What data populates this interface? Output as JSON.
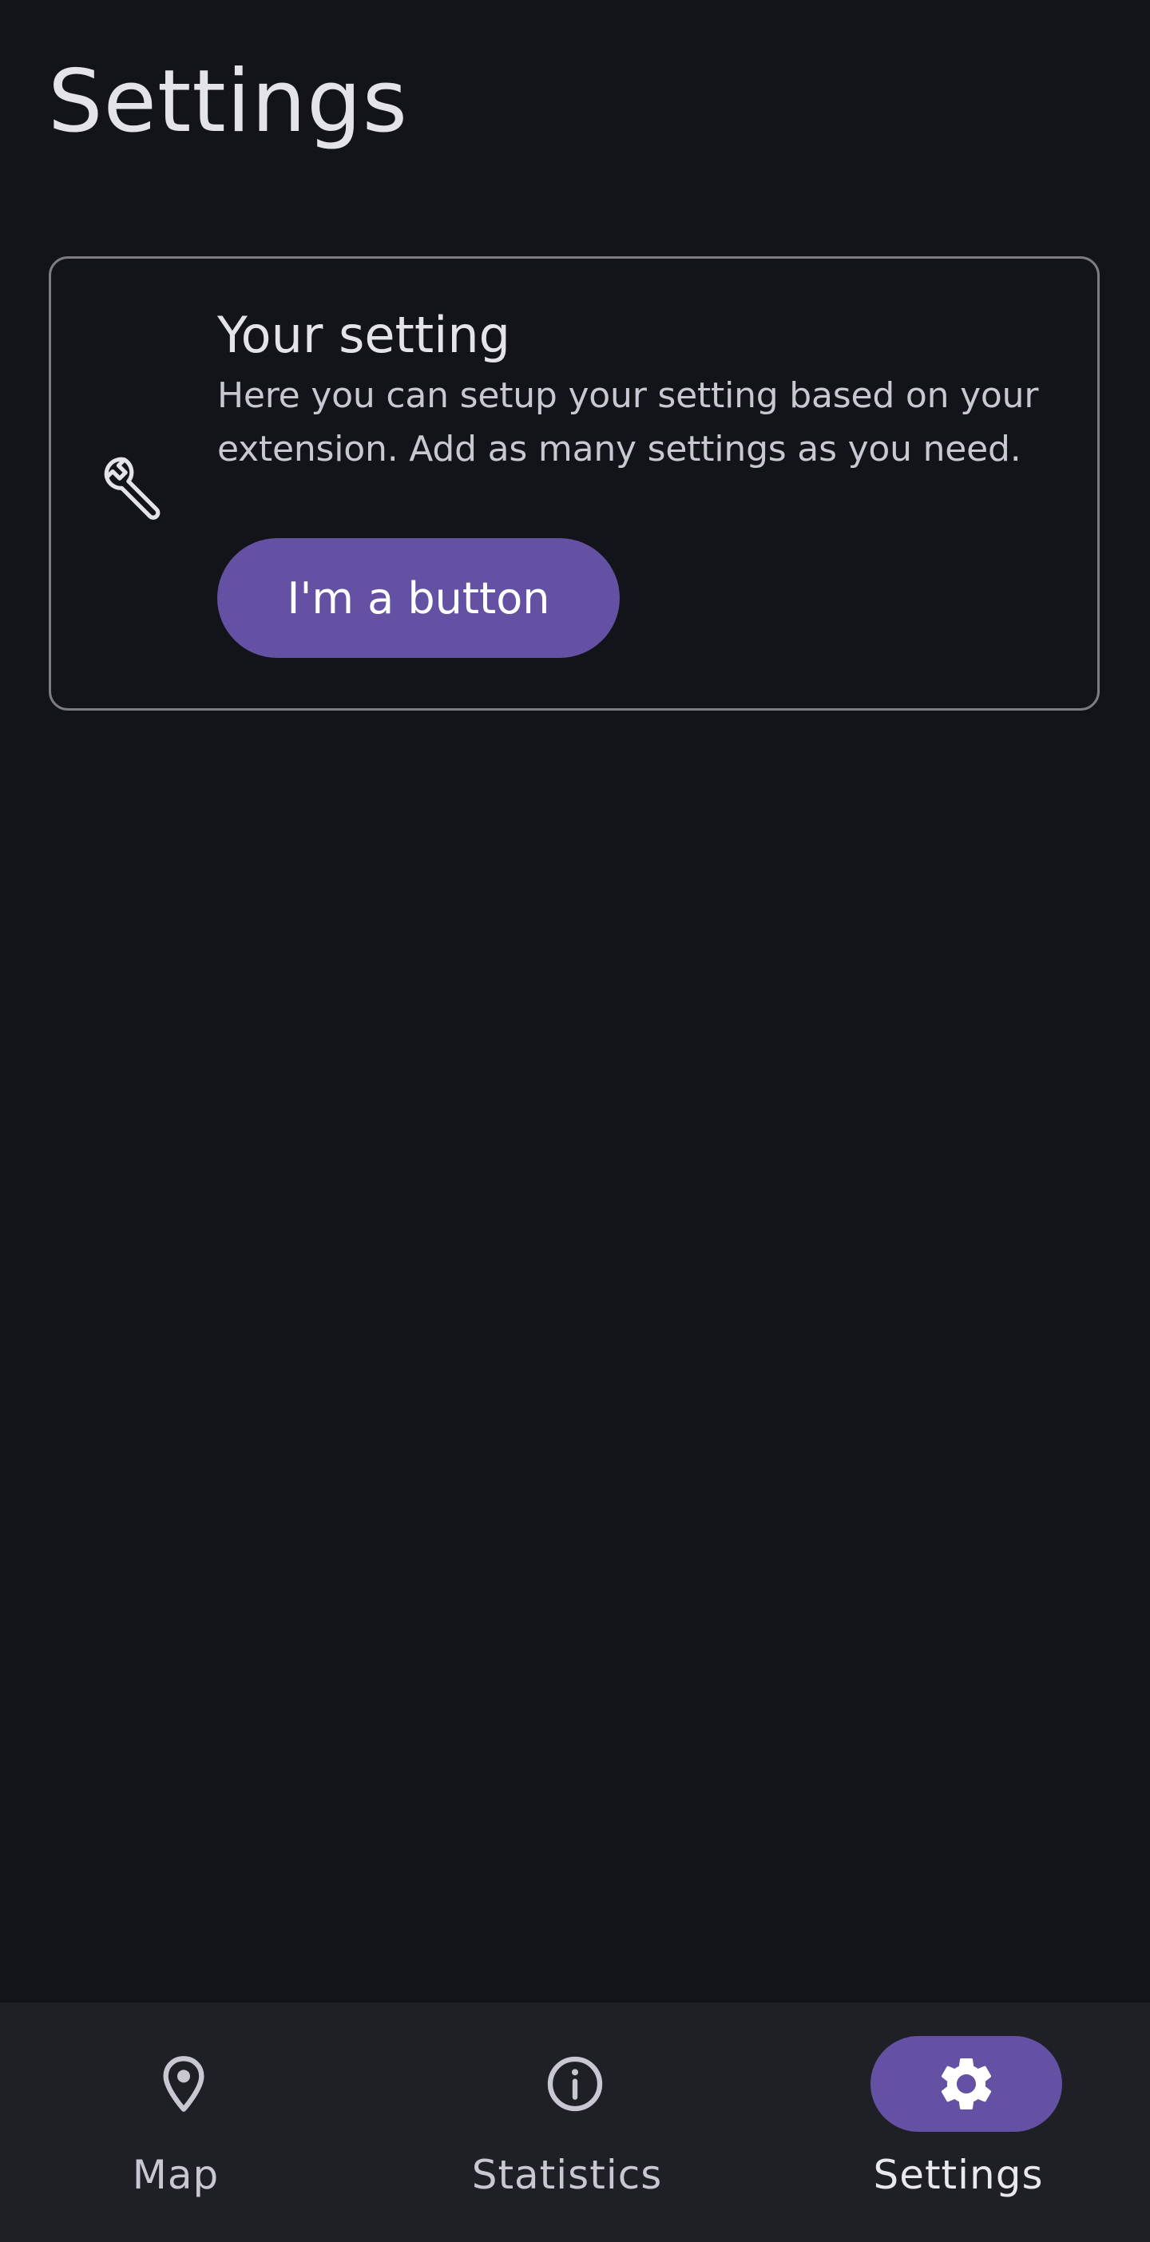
{
  "page": {
    "title": "Settings"
  },
  "setting_card": {
    "icon": "wrench-icon",
    "title": "Your setting",
    "description": "Here you can setup your setting based on your extension. Add as many settings as you need.",
    "button_label": "I'm a button"
  },
  "bottom_nav": {
    "items": [
      {
        "label": "Map",
        "icon": "map-pin-icon",
        "active": false
      },
      {
        "label": "Statistics",
        "icon": "info-icon",
        "active": false
      },
      {
        "label": "Settings",
        "icon": "gear-icon",
        "active": true
      }
    ]
  },
  "colors": {
    "background": "#131419",
    "nav_background": "#1f1f26",
    "accent": "#6551a3",
    "card_border": "#7d7c85",
    "text_primary": "#e4e3ea",
    "text_secondary": "#c9c7d1"
  }
}
